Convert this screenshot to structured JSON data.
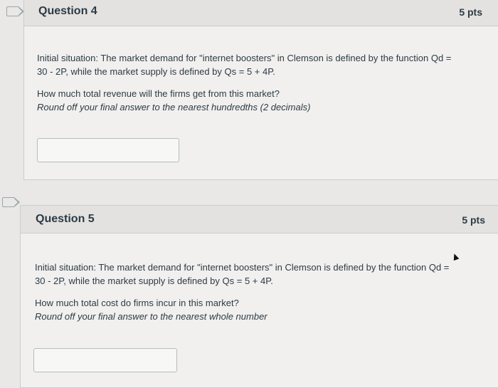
{
  "q4": {
    "title": "Question 4",
    "points": "5 pts",
    "text_line1": "Initial situation: The market demand for \"internet boosters\" in Clemson is defined by the function Qd =",
    "text_line2": "30 - 2P, while the market supply is defined by Qs = 5 + 4P.",
    "question": "How much total revenue will the firms get from this market?",
    "instruction": "Round off your final answer to the nearest hundredths (2 decimals)",
    "answer_value": ""
  },
  "q5": {
    "title": "Question 5",
    "points": "5 pts",
    "text_line1": "Initial situation: The market demand for \"internet boosters\" in Clemson is defined by the function Qd =",
    "text_line2": "30 - 2P, while the market supply is defined by Qs = 5 + 4P.",
    "question": "How much total cost do firms incur in this market?",
    "instruction": "Round off your final answer to the nearest whole number",
    "answer_value": ""
  },
  "icons": {
    "flag": "flag-question-icon",
    "cursor": "mouse-cursor-icon"
  },
  "colors": {
    "page_bg": "#e9e8e6",
    "header_bg": "#e3e2e0",
    "body_bg": "#f1f0ee",
    "text": "#2d3b45",
    "border": "#c7cdd1"
  }
}
